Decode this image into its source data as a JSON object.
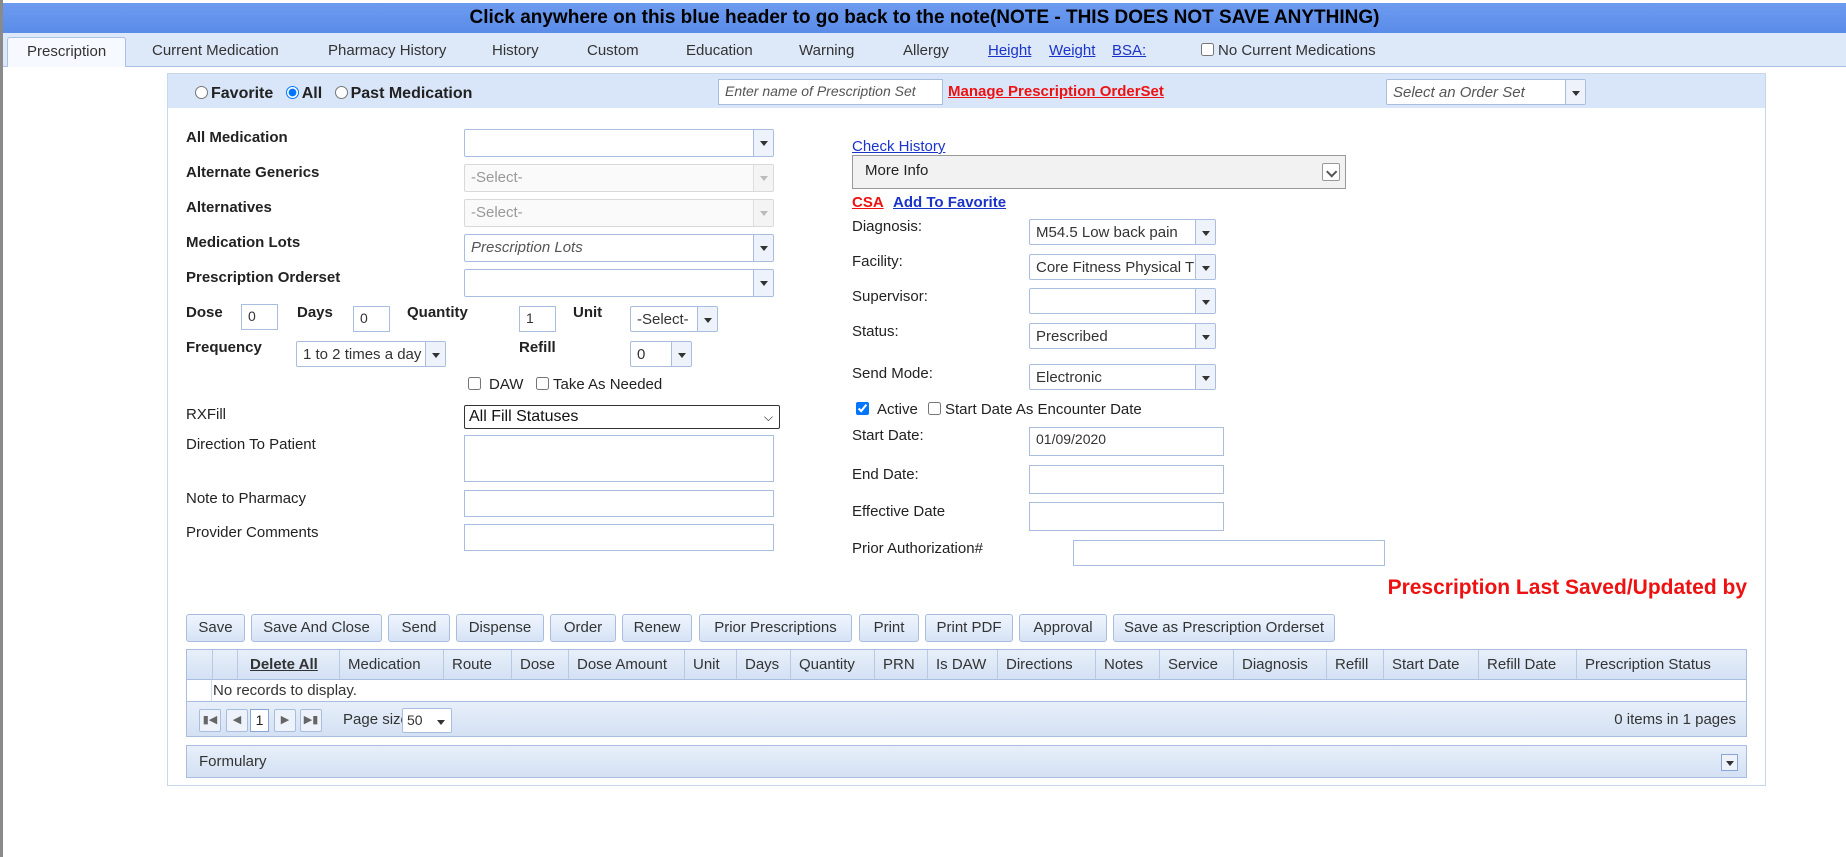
{
  "header": {
    "text": "Click anywhere on this blue header to go back to the note(NOTE - THIS DOES NOT SAVE ANYTHING)"
  },
  "tabs": [
    {
      "label": "Prescription"
    },
    {
      "label": "Current Medication"
    },
    {
      "label": "Pharmacy History"
    },
    {
      "label": "History"
    },
    {
      "label": "Custom"
    },
    {
      "label": "Education"
    },
    {
      "label": "Warning"
    },
    {
      "label": "Allergy"
    }
  ],
  "tab_links": {
    "height": "Height",
    "weight": "Weight",
    "bsa": "BSA:"
  },
  "no_current_medications": "No Current Medications",
  "filter": {
    "favorite": "Favorite",
    "all": "All",
    "past": "Past Medication",
    "selected": "All",
    "prescription_set_placeholder": "Enter name of Prescription Set",
    "manage_link": "Manage Prescription OrderSet",
    "order_set_placeholder": "Select an Order Set"
  },
  "left_form": {
    "all_medication": "All  Medication",
    "alternate_generics": "Alternate Generics",
    "alternate_generics_value": "-Select-",
    "alternatives": "Alternatives",
    "alternatives_value": "-Select-",
    "medication_lots": "Medication Lots",
    "medication_lots_placeholder": "Prescription Lots",
    "prescription_orderset": "Prescription Orderset",
    "dose": "Dose",
    "dose_value": "0",
    "days": "Days",
    "days_value": "0",
    "quantity": "Quantity",
    "quantity_value": "1",
    "unit": "Unit",
    "unit_value": "-Select-",
    "frequency": "Frequency",
    "frequency_value": "1 to 2 times a day",
    "refill": "Refill",
    "refill_value": "0",
    "daw": "DAW",
    "take_as_needed": "Take As Needed",
    "rxfill": "RXFill",
    "rxfill_value": "All Fill Statuses",
    "direction_to_patient": "Direction To Patient",
    "note_to_pharmacy": "Note to Pharmacy",
    "provider_comments": "Provider Comments"
  },
  "right_form": {
    "check_history": "Check History",
    "more_info": "More Info",
    "csa": "CSA",
    "add_to_favorite": "Add To Favorite",
    "diagnosis": "Diagnosis:",
    "diagnosis_value": "M54.5 Low back pain",
    "facility": "Facility:",
    "facility_value": "Core Fitness Physical Th",
    "supervisor": "Supervisor:",
    "supervisor_value": "",
    "status": "Status:",
    "status_value": "Prescribed",
    "send_mode": "Send Mode:",
    "send_mode_value": "Electronic",
    "active": "Active",
    "start_as_encounter": "Start Date As Encounter Date",
    "start_date": "Start Date:",
    "start_date_value": "01/09/2020",
    "end_date": "End Date:",
    "effective_date": "Effective Date",
    "prior_authorization": "Prior Authorization#"
  },
  "last_saved": "Prescription Last Saved/Updated by",
  "buttons": [
    "Save",
    "Save And Close",
    "Send",
    "Dispense",
    "Order",
    "Renew",
    "Prior Prescriptions",
    "Print",
    "Print PDF",
    "Approval",
    "Save as Prescription Orderset"
  ],
  "grid": {
    "columns": [
      "Delete All",
      "Medication",
      "Route",
      "Dose",
      "Dose Amount",
      "Unit",
      "Days",
      "Quantity",
      "PRN",
      "Is DAW",
      "Directions",
      "Notes",
      "Service",
      "Diagnosis",
      "Refill",
      "Start Date",
      "Refill Date",
      "Prescription Status"
    ],
    "no_records": "No records to display.",
    "page": "1",
    "page_size_label": "Page size:",
    "page_size": "50",
    "items_info": "0 items in 1 pages"
  },
  "formulary": "Formulary"
}
